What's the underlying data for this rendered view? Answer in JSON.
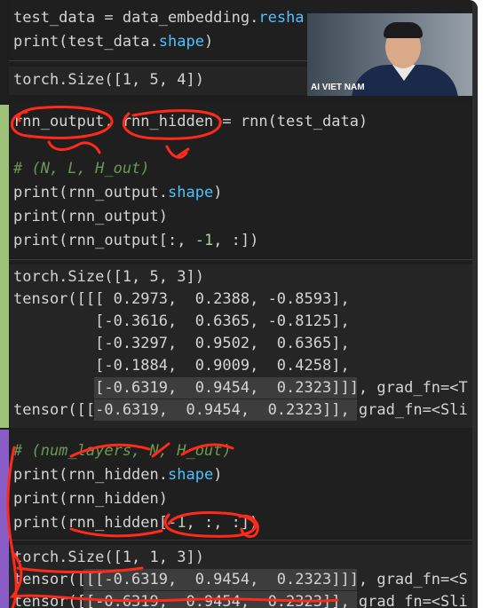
{
  "colors": {
    "ink": "#ff2a1a",
    "green_gutter": "#9ec27a",
    "purple_gutter": "#8a5cc6"
  },
  "cell1": {
    "line1": {
      "a": "test_data",
      "b": " = data_embedding.",
      "c": "resha"
    },
    "line2": {
      "a": "print(test_data.",
      "b": "shape",
      "c": ")"
    },
    "output": "torch.Size([1, 5, 4])"
  },
  "cell2": {
    "line1": {
      "a": "rnn_output, rnn_hidden = rnn(test_data)"
    },
    "comment": "# (N, L, H_out)",
    "line3": {
      "a": "print(rnn_output.",
      "b": "shape",
      "c": ")"
    },
    "line4": "print(rnn_output)",
    "line5": {
      "a": "print(rnn_output[:, ",
      "b": "-1",
      "c": ", :])"
    },
    "out": [
      "torch.Size([1, 5, 3])",
      "tensor([[[ 0.2973,  0.2388, -0.8593],",
      "         [-0.3616,  0.6365, -0.8125],",
      "         [-0.3297,  0.9502,  0.6365],",
      "         [-0.1884,  0.9009,  0.4258],",
      "         [-0.6319,  0.9454,  0.2323]]], grad_fn=<T",
      "tensor([[-0.6319,  0.9454,  0.2323]], grad_fn=<Sli"
    ]
  },
  "cell3": {
    "comment": "# (num_layers, N, H_out)",
    "line2": {
      "a": "print(rnn_hidden.",
      "b": "shape",
      "c": ")"
    },
    "line3": "print(rnn_hidden)",
    "line4": {
      "a": "print(rnn_hidden[",
      "b": "-1",
      "c": ", :, :])"
    },
    "out": [
      "torch.Size([1, 1, 3])",
      "tensor([[[-0.6319,  0.9454,  0.2323]]], grad_fn=<S",
      "tensor([[-0.6319,  0.9454,  0.2323]], grad_fn=<Sli"
    ]
  },
  "video": {
    "label": "AI VIET NAM"
  }
}
